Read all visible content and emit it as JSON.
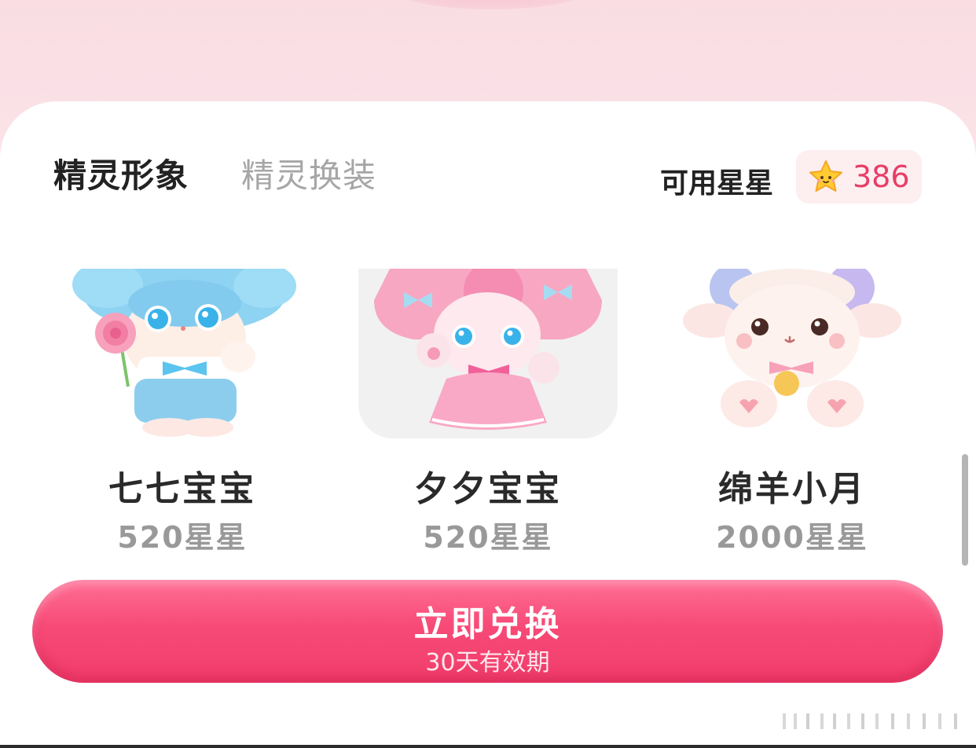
{
  "tabs": {
    "active": "精灵形象",
    "inactive": "精灵换装"
  },
  "stars": {
    "label": "可用星星",
    "count": "386",
    "icon": "star-icon"
  },
  "items": [
    {
      "name": "七七宝宝",
      "price": "520星星",
      "selected": false
    },
    {
      "name": "夕夕宝宝",
      "price": "520星星",
      "selected": true
    },
    {
      "name": "绵羊小月",
      "price": "2000星星",
      "selected": false
    }
  ],
  "exchange": {
    "label": "立即兑换",
    "sub": "30天有效期"
  },
  "colors": {
    "accent": "#f24a74",
    "price_count": "#e83d68",
    "bg_pink": "#fbe0e6"
  }
}
